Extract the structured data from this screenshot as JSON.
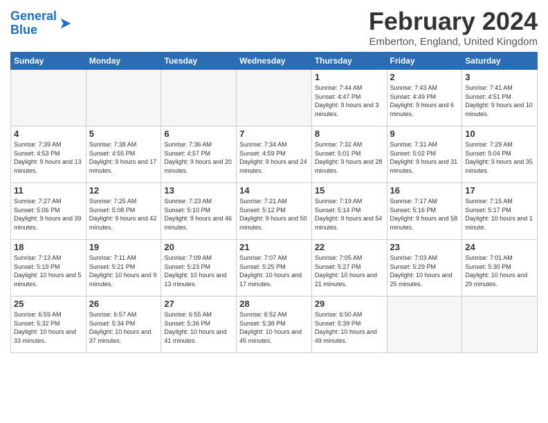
{
  "header": {
    "logo_line1": "General",
    "logo_line2": "Blue",
    "month_title": "February 2024",
    "location": "Emberton, England, United Kingdom"
  },
  "weekdays": [
    "Sunday",
    "Monday",
    "Tuesday",
    "Wednesday",
    "Thursday",
    "Friday",
    "Saturday"
  ],
  "weeks": [
    [
      {
        "day": "",
        "empty": true
      },
      {
        "day": "",
        "empty": true
      },
      {
        "day": "",
        "empty": true
      },
      {
        "day": "",
        "empty": true
      },
      {
        "day": "1",
        "sunrise": "7:44 AM",
        "sunset": "4:47 PM",
        "daylight": "9 hours and 3 minutes."
      },
      {
        "day": "2",
        "sunrise": "7:43 AM",
        "sunset": "4:49 PM",
        "daylight": "9 hours and 6 minutes."
      },
      {
        "day": "3",
        "sunrise": "7:41 AM",
        "sunset": "4:51 PM",
        "daylight": "9 hours and 10 minutes."
      }
    ],
    [
      {
        "day": "4",
        "sunrise": "7:39 AM",
        "sunset": "4:53 PM",
        "daylight": "9 hours and 13 minutes."
      },
      {
        "day": "5",
        "sunrise": "7:38 AM",
        "sunset": "4:55 PM",
        "daylight": "9 hours and 17 minutes."
      },
      {
        "day": "6",
        "sunrise": "7:36 AM",
        "sunset": "4:57 PM",
        "daylight": "9 hours and 20 minutes."
      },
      {
        "day": "7",
        "sunrise": "7:34 AM",
        "sunset": "4:59 PM",
        "daylight": "9 hours and 24 minutes."
      },
      {
        "day": "8",
        "sunrise": "7:32 AM",
        "sunset": "5:01 PM",
        "daylight": "9 hours and 28 minutes."
      },
      {
        "day": "9",
        "sunrise": "7:31 AM",
        "sunset": "5:02 PM",
        "daylight": "9 hours and 31 minutes."
      },
      {
        "day": "10",
        "sunrise": "7:29 AM",
        "sunset": "5:04 PM",
        "daylight": "9 hours and 35 minutes."
      }
    ],
    [
      {
        "day": "11",
        "sunrise": "7:27 AM",
        "sunset": "5:06 PM",
        "daylight": "9 hours and 39 minutes."
      },
      {
        "day": "12",
        "sunrise": "7:25 AM",
        "sunset": "5:08 PM",
        "daylight": "9 hours and 42 minutes."
      },
      {
        "day": "13",
        "sunrise": "7:23 AM",
        "sunset": "5:10 PM",
        "daylight": "9 hours and 46 minutes."
      },
      {
        "day": "14",
        "sunrise": "7:21 AM",
        "sunset": "5:12 PM",
        "daylight": "9 hours and 50 minutes."
      },
      {
        "day": "15",
        "sunrise": "7:19 AM",
        "sunset": "5:14 PM",
        "daylight": "9 hours and 54 minutes."
      },
      {
        "day": "16",
        "sunrise": "7:17 AM",
        "sunset": "5:16 PM",
        "daylight": "9 hours and 58 minutes."
      },
      {
        "day": "17",
        "sunrise": "7:15 AM",
        "sunset": "5:17 PM",
        "daylight": "10 hours and 1 minute."
      }
    ],
    [
      {
        "day": "18",
        "sunrise": "7:13 AM",
        "sunset": "5:19 PM",
        "daylight": "10 hours and 5 minutes."
      },
      {
        "day": "19",
        "sunrise": "7:11 AM",
        "sunset": "5:21 PM",
        "daylight": "10 hours and 9 minutes."
      },
      {
        "day": "20",
        "sunrise": "7:09 AM",
        "sunset": "5:23 PM",
        "daylight": "10 hours and 13 minutes."
      },
      {
        "day": "21",
        "sunrise": "7:07 AM",
        "sunset": "5:25 PM",
        "daylight": "10 hours and 17 minutes."
      },
      {
        "day": "22",
        "sunrise": "7:05 AM",
        "sunset": "5:27 PM",
        "daylight": "10 hours and 21 minutes."
      },
      {
        "day": "23",
        "sunrise": "7:03 AM",
        "sunset": "5:29 PM",
        "daylight": "10 hours and 25 minutes."
      },
      {
        "day": "24",
        "sunrise": "7:01 AM",
        "sunset": "5:30 PM",
        "daylight": "10 hours and 29 minutes."
      }
    ],
    [
      {
        "day": "25",
        "sunrise": "6:59 AM",
        "sunset": "5:32 PM",
        "daylight": "10 hours and 33 minutes."
      },
      {
        "day": "26",
        "sunrise": "6:57 AM",
        "sunset": "5:34 PM",
        "daylight": "10 hours and 37 minutes."
      },
      {
        "day": "27",
        "sunrise": "6:55 AM",
        "sunset": "5:36 PM",
        "daylight": "10 hours and 41 minutes."
      },
      {
        "day": "28",
        "sunrise": "6:52 AM",
        "sunset": "5:38 PM",
        "daylight": "10 hours and 45 minutes."
      },
      {
        "day": "29",
        "sunrise": "6:50 AM",
        "sunset": "5:39 PM",
        "daylight": "10 hours and 49 minutes."
      },
      {
        "day": "",
        "empty": true
      },
      {
        "day": "",
        "empty": true
      }
    ]
  ],
  "labels": {
    "sunrise_prefix": "Sunrise: ",
    "sunset_prefix": "Sunset: ",
    "daylight_prefix": "Daylight: "
  }
}
